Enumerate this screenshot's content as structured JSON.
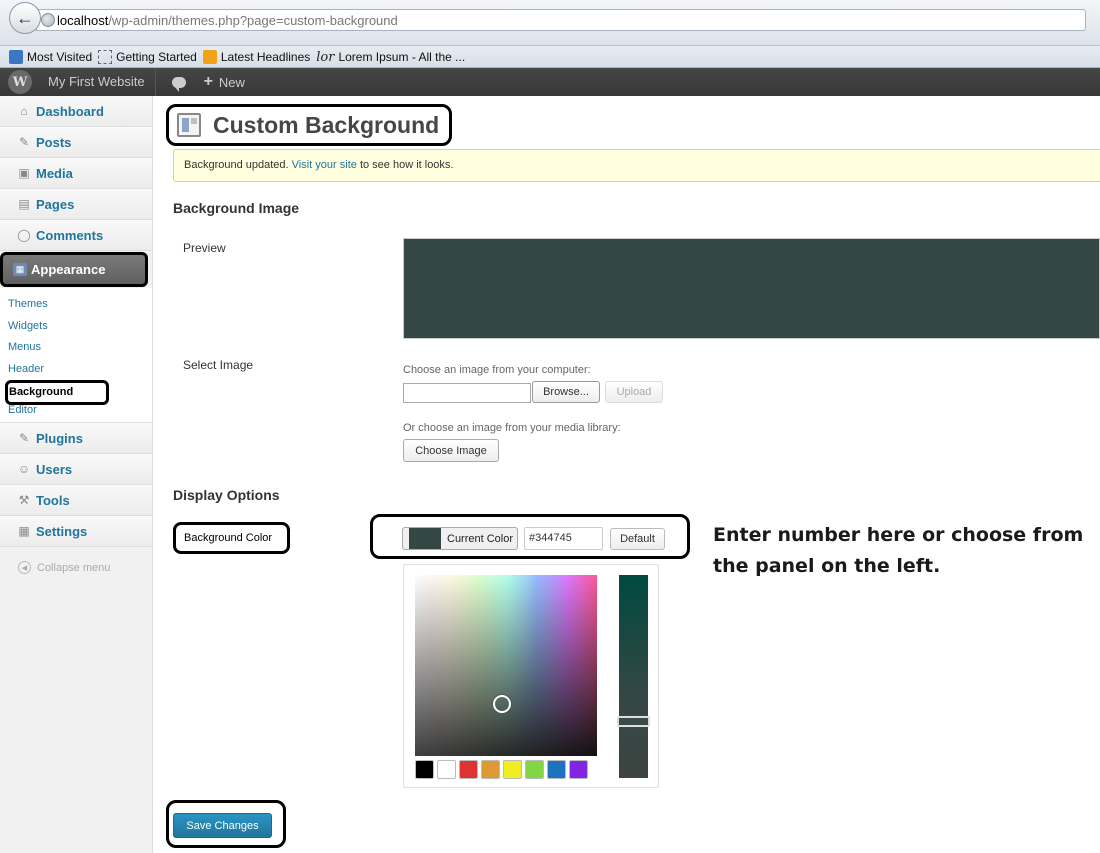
{
  "browser": {
    "url_host": "localhost",
    "url_path": "/wp-admin/themes.php?page=custom-background",
    "back_icon": "back-arrow-icon",
    "bookmarks": [
      {
        "label": "Most Visited",
        "icon": "most-visited-icon"
      },
      {
        "label": "Getting Started",
        "icon": "bookmark-page-icon"
      },
      {
        "label": "Latest Headlines",
        "icon": "rss-icon"
      },
      {
        "label": "Lorem Ipsum - All the ...",
        "icon": "lorem-icon"
      }
    ]
  },
  "adminbar": {
    "logo": "wordpress-logo-icon",
    "site_name": "My First Website",
    "new_plus": "+",
    "new_label": "New"
  },
  "sidebar": {
    "items": [
      {
        "label": "Dashboard",
        "icon": "home-icon",
        "glyph": "⌂"
      },
      {
        "label": "Posts",
        "icon": "pin-icon",
        "glyph": "✎"
      },
      {
        "label": "Media",
        "icon": "media-icon",
        "glyph": "▣"
      },
      {
        "label": "Pages",
        "icon": "pages-icon",
        "glyph": "▤"
      },
      {
        "label": "Comments",
        "icon": "comment-icon",
        "glyph": "◯"
      },
      {
        "label": "Appearance",
        "icon": "appearance-icon",
        "glyph": "▦"
      },
      {
        "label": "Plugins",
        "icon": "plugin-icon",
        "glyph": "✎"
      },
      {
        "label": "Users",
        "icon": "users-icon",
        "glyph": "☺"
      },
      {
        "label": "Tools",
        "icon": "tools-icon",
        "glyph": "⚒"
      },
      {
        "label": "Settings",
        "icon": "settings-icon",
        "glyph": "▦"
      }
    ],
    "submenu": [
      "Themes",
      "Widgets",
      "Menus",
      "Header",
      "Background",
      "Editor"
    ],
    "collapse_label": "Collapse menu",
    "collapse_glyph": "◀"
  },
  "page": {
    "title": "Custom Background",
    "notice_prefix": "Background updated.",
    "notice_link": "Visit your site",
    "notice_suffix": "to see how it looks.",
    "section_bg_image": "Background Image",
    "preview_label": "Preview",
    "preview_color": "#344745",
    "select_image_label": "Select Image",
    "choose_from_computer": "Choose an image from your computer:",
    "browse_button": "Browse...",
    "upload_button": "Upload",
    "choose_from_library": "Or choose an image from your media library:",
    "choose_image_button": "Choose Image",
    "section_display": "Display Options",
    "bg_color_label": "Background Color",
    "current_color_button": "Current Color",
    "hex_value": "#344745",
    "default_button": "Default",
    "annotation": "Enter number here or choose from the panel on the left.",
    "palette": [
      "#000000",
      "#ffffff",
      "#dd3333",
      "#dd9933",
      "#eeee22",
      "#81d742",
      "#1e73be",
      "#8224e3"
    ],
    "save_button": "Save Changes"
  },
  "colors": {
    "accent": "#21759b",
    "admin_bar": "#464646",
    "notice_bg": "#ffffe0",
    "save_button": "#21759b"
  }
}
